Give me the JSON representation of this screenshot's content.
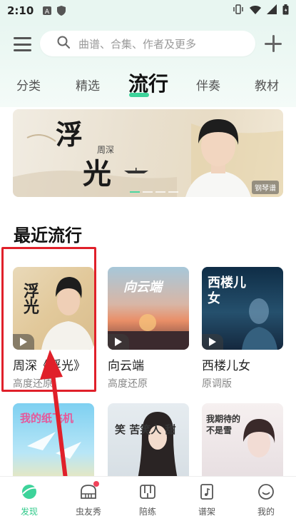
{
  "status_bar": {
    "time": "2:10"
  },
  "header": {
    "search_placeholder": "曲谱、合集、作者及更多",
    "tabs": [
      {
        "label": "分类"
      },
      {
        "label": "精选"
      },
      {
        "label": "流行"
      },
      {
        "label": "伴奏"
      },
      {
        "label": "教材"
      }
    ],
    "active_tab": "流行"
  },
  "banner": {
    "calligraphy_1": "浮",
    "calligraphy_2": "光",
    "singer": "周深",
    "tag": "钢琴谱"
  },
  "section": {
    "title": "最近流行",
    "items": [
      {
        "title": "周深《浮光》",
        "subtitle": "高度还原",
        "cover_text": "浮光"
      },
      {
        "title": "向云端",
        "subtitle": "高度还原",
        "cover_text": "向云端"
      },
      {
        "title": "西楼儿女",
        "subtitle": "原调版",
        "cover_text": "西楼儿女"
      },
      {
        "title": "",
        "subtitle": "",
        "cover_text": "我的纸飞机"
      },
      {
        "title": "",
        "subtitle": "",
        "cover_text": "笑 苦笑人 甜"
      },
      {
        "title": "",
        "subtitle": "",
        "cover_text": "我期待的不是雪"
      }
    ]
  },
  "bottom_nav": [
    {
      "label": "发现",
      "icon": "discover-icon"
    },
    {
      "label": "虫友秀",
      "icon": "piano-icon"
    },
    {
      "label": "陪练",
      "icon": "keyboard-icon"
    },
    {
      "label": "谱架",
      "icon": "music-sheet-icon"
    },
    {
      "label": "我的",
      "icon": "profile-icon"
    }
  ],
  "colors": {
    "accent": "#2ec989",
    "highlight": "#e0202a"
  }
}
